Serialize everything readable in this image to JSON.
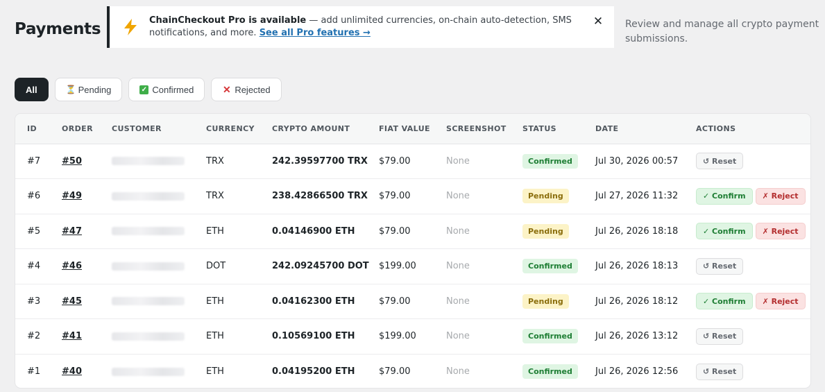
{
  "page": {
    "title": "Payments",
    "subtitle": "Review and manage all crypto payment submissions."
  },
  "notice": {
    "icon": "lightning-bolt-icon",
    "title": "ChainCheckout Pro is available",
    "body": " — add unlimited currencies, on-chain auto-detection, SMS notifications, and more. ",
    "link_label": "See all Pro features →",
    "close_glyph": "✕"
  },
  "filters": [
    {
      "label": "All",
      "icon": "",
      "active": true
    },
    {
      "label": "Pending",
      "icon": "hourglass-icon",
      "glyph": "⏳",
      "active": false
    },
    {
      "label": "Confirmed",
      "icon": "check-box-icon",
      "glyph": "✓",
      "active": false
    },
    {
      "label": "Rejected",
      "icon": "cross-icon",
      "glyph": "✕",
      "active": false
    }
  ],
  "table": {
    "columns": [
      "ID",
      "ORDER",
      "CUSTOMER",
      "CURRENCY",
      "CRYPTO AMOUNT",
      "FIAT VALUE",
      "SCREENSHOT",
      "STATUS",
      "DATE",
      "ACTIONS"
    ],
    "rows": [
      {
        "id": "#7",
        "order": "#50",
        "currency": "TRX",
        "amount": "242.39597700 TRX",
        "fiat": "$79.00",
        "screenshot": "None",
        "status": "Confirmed",
        "date": "Jul 30, 2026 00:57"
      },
      {
        "id": "#6",
        "order": "#49",
        "currency": "TRX",
        "amount": "238.42866500 TRX",
        "fiat": "$79.00",
        "screenshot": "None",
        "status": "Pending",
        "date": "Jul 27, 2026 11:32"
      },
      {
        "id": "#5",
        "order": "#47",
        "currency": "ETH",
        "amount": "0.04146900 ETH",
        "fiat": "$79.00",
        "screenshot": "None",
        "status": "Pending",
        "date": "Jul 26, 2026 18:18"
      },
      {
        "id": "#4",
        "order": "#46",
        "currency": "DOT",
        "amount": "242.09245700 DOT",
        "fiat": "$199.00",
        "screenshot": "None",
        "status": "Confirmed",
        "date": "Jul 26, 2026 18:13"
      },
      {
        "id": "#3",
        "order": "#45",
        "currency": "ETH",
        "amount": "0.04162300 ETH",
        "fiat": "$79.00",
        "screenshot": "None",
        "status": "Pending",
        "date": "Jul 26, 2026 18:12"
      },
      {
        "id": "#2",
        "order": "#41",
        "currency": "ETH",
        "amount": "0.10569100 ETH",
        "fiat": "$199.00",
        "screenshot": "None",
        "status": "Confirmed",
        "date": "Jul 26, 2026 13:12"
      },
      {
        "id": "#1",
        "order": "#40",
        "currency": "ETH",
        "amount": "0.04195200 ETH",
        "fiat": "$79.00",
        "screenshot": "None",
        "status": "Confirmed",
        "date": "Jul 26, 2026 12:56"
      }
    ]
  },
  "actions": {
    "reset_label": "↺ Reset",
    "confirm_label": "✓ Confirm",
    "reject_label": "✗ Reject"
  },
  "colors": {
    "brand_dark": "#1d2327",
    "link": "#2271b1",
    "confirmed_bg": "#dff5e3",
    "pending_bg": "#fcf3c7",
    "reject_bg": "#fbe2e2"
  }
}
